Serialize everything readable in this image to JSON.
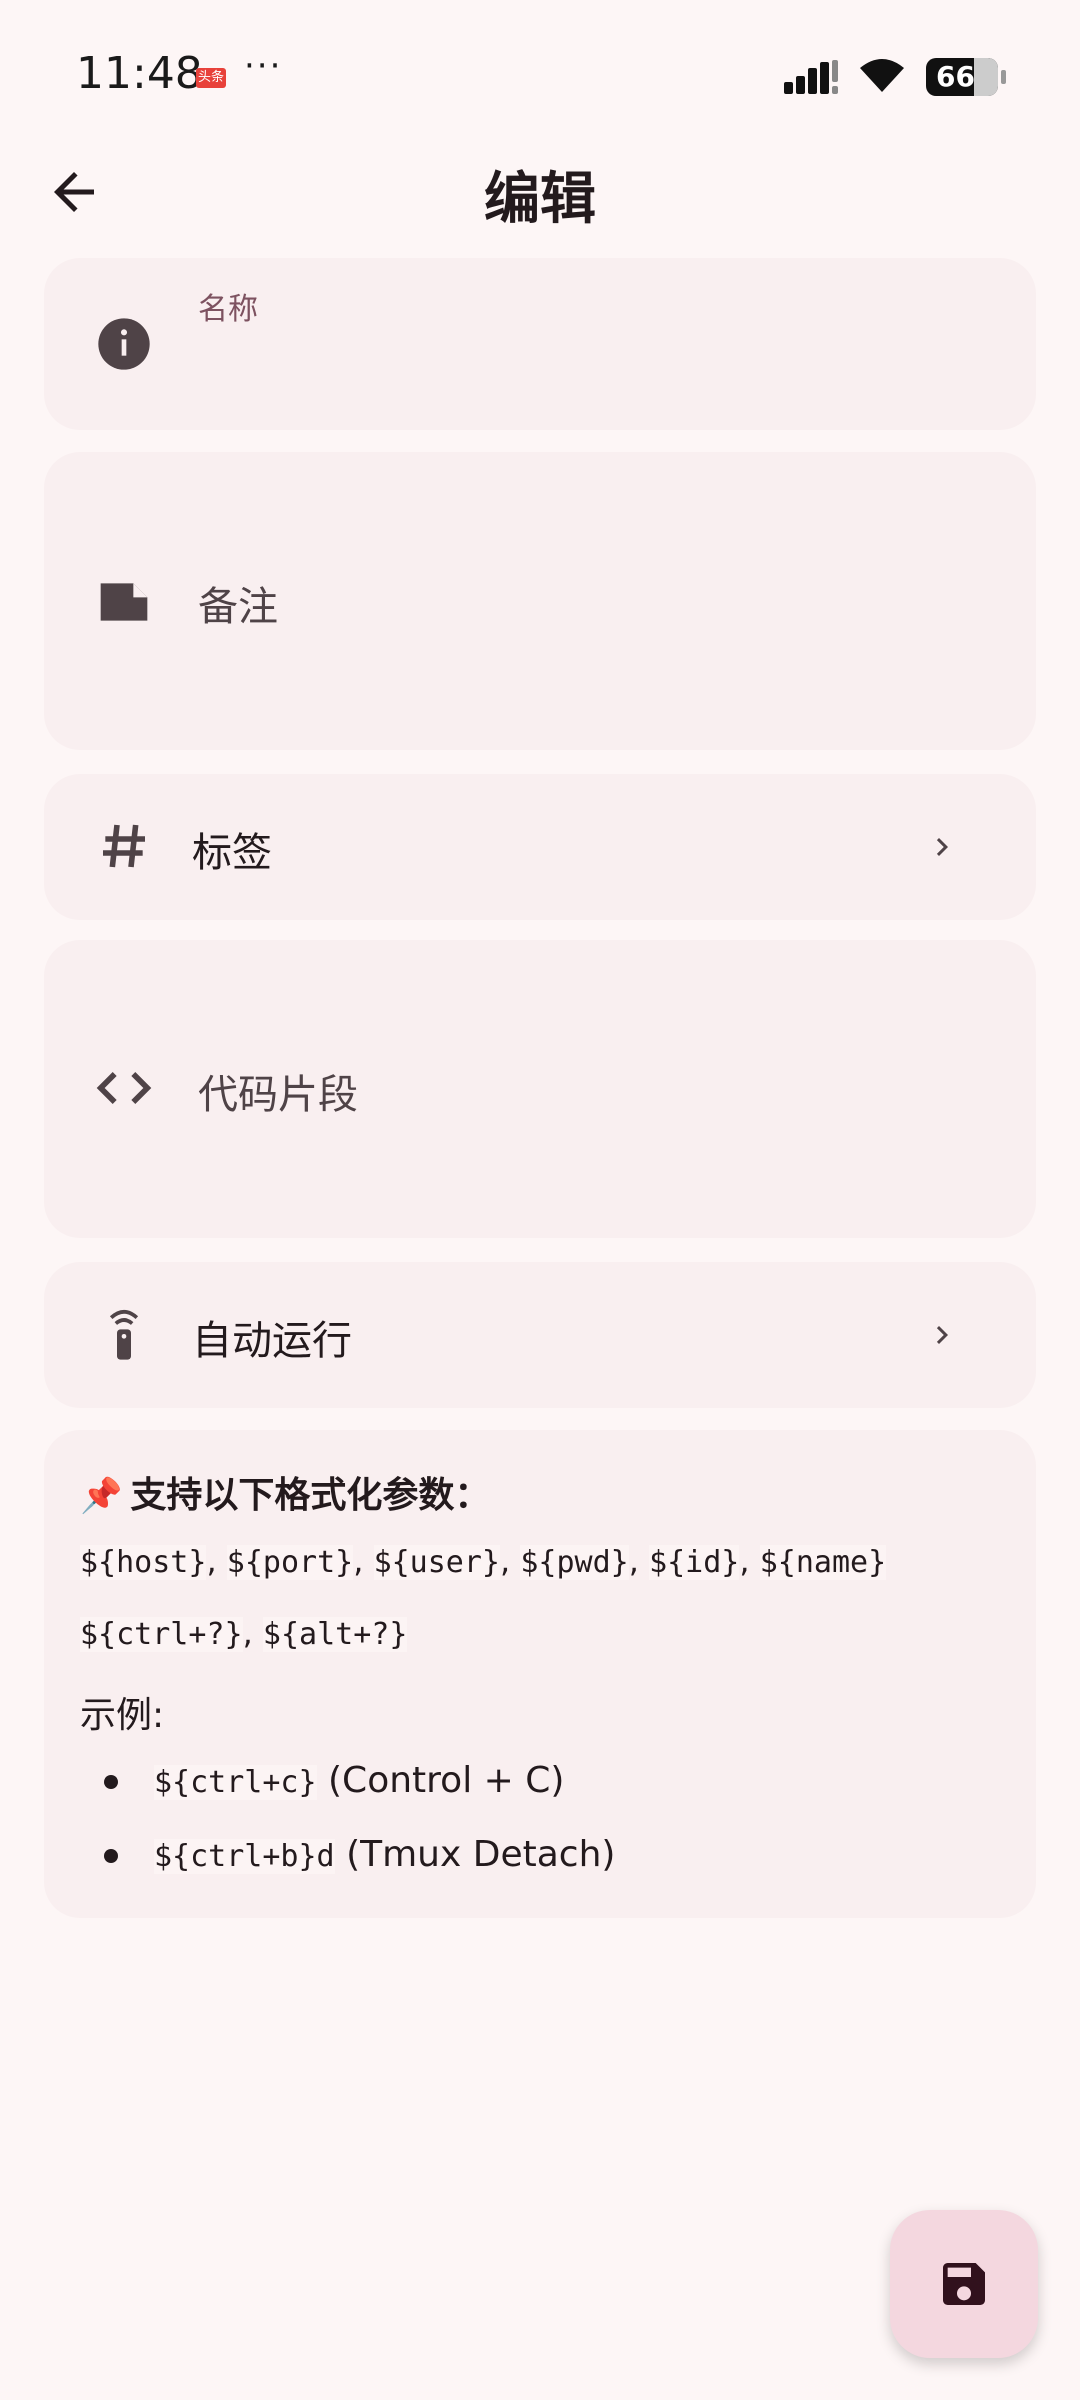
{
  "status_bar": {
    "time": "11:48",
    "app_badge": "头条",
    "more": "···",
    "battery": "66"
  },
  "header": {
    "title": "编辑"
  },
  "fields": {
    "name_label": "名称",
    "note_label": "备注",
    "tags_label": "标签",
    "code_label": "代码片段",
    "auto_run_label": "自动运行"
  },
  "info": {
    "pin": "📌",
    "heading": "支持以下格式化参数：",
    "params_line1": [
      "${host}",
      "${port}",
      "${user}",
      "${pwd}",
      "${id}",
      "${name}"
    ],
    "params_line2": [
      "${ctrl+?}",
      "${alt+?}"
    ],
    "example_title": "示例:",
    "examples": [
      {
        "code": "${ctrl+c}",
        "desc": "(Control + C)"
      },
      {
        "code": "${ctrl+b}d",
        "desc": "(Tmux Detach)"
      }
    ]
  },
  "icons": {
    "back": "arrow-back-icon",
    "name": "info-icon",
    "note": "note-icon",
    "tags": "hash-icon",
    "code": "code-icon",
    "auto_run": "remote-icon",
    "chevron": "chevron-right-icon",
    "save": "save-icon"
  },
  "colors": {
    "background": "#fdf6f6",
    "card": "#f9eff0",
    "accent": "#7d5260",
    "fab": "#f4d7df"
  }
}
